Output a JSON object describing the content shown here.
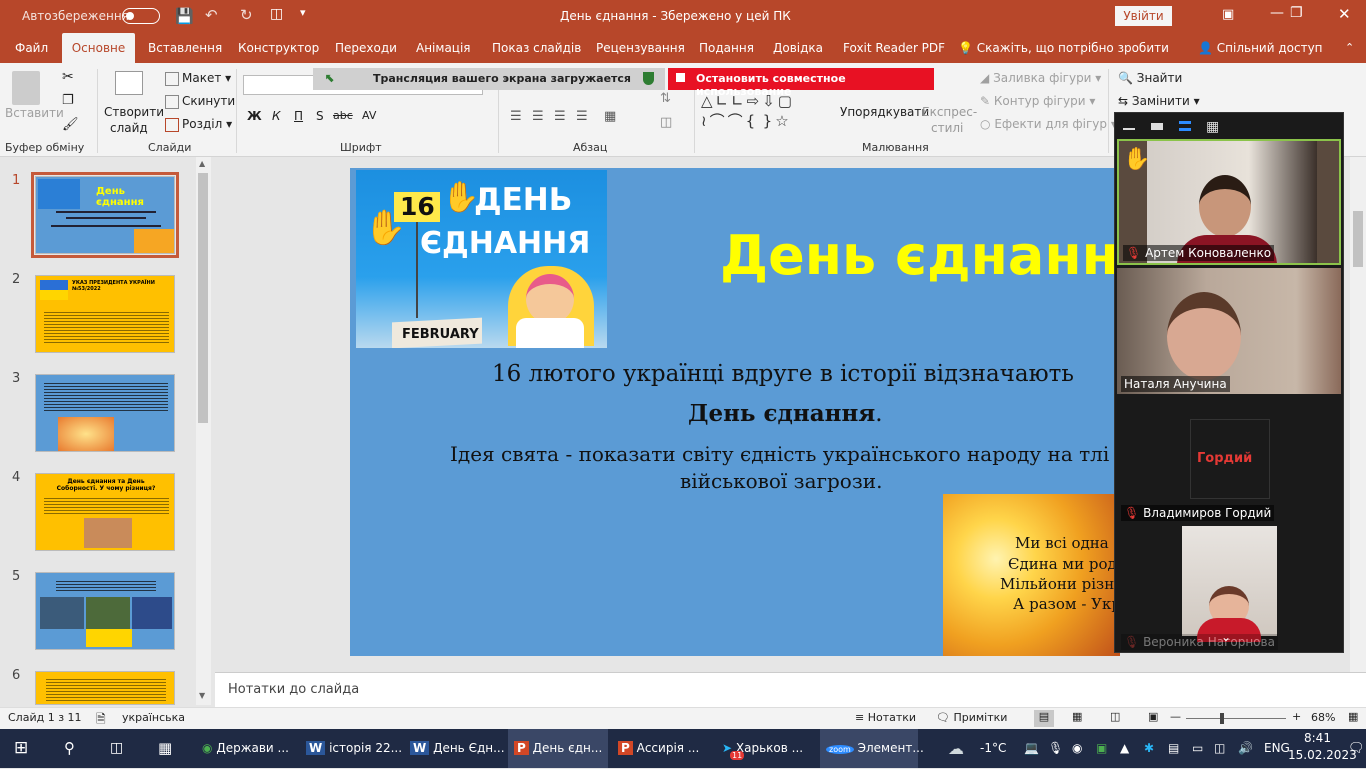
{
  "titlebar": {
    "autosave": "Автозбереження",
    "title": "День єднання  -  Збережено у цей ПК",
    "signin": "Увійти"
  },
  "tabs": [
    "Файл",
    "Основне",
    "Вставлення",
    "Конструктор",
    "Переходи",
    "Анімація",
    "Показ слайдів",
    "Рецензування",
    "Подання",
    "Довідка",
    "Foxit Reader PDF"
  ],
  "tellme": "Скажіть, що потрібно зробити",
  "share": "Спільний доступ",
  "ribbon": {
    "paste": "Вставити",
    "new_slide_1": "Створити",
    "new_slide_2": "слайд",
    "layout": "Макет",
    "reset": "Скинути",
    "section": "Розділ",
    "bold": "Ж",
    "italic": "К",
    "underline": "П",
    "strike": "S",
    "abc": "abc",
    "spacing": "AV",
    "arrange": "Упорядкувати",
    "quick_1": "Експрес-",
    "quick_2": "стилі",
    "fill": "Заливка фігури",
    "outline": "Контур фігури",
    "effects": "Ефекти для фігур",
    "find": "Знайти",
    "replace": "Замінити",
    "groups": {
      "clipboard": "Буфер обміну",
      "slides": "Слайди",
      "font": "Шрифт",
      "paragraph": "Абзац",
      "drawing": "Малювання"
    }
  },
  "screenshare": {
    "loading": "Трансляция вашего экрана загружается",
    "stop": "Остановить совместное использование"
  },
  "thumbnails": [
    {
      "num": "1",
      "title": "День єднання"
    },
    {
      "num": "2",
      "title": "УКАЗ ПРЕЗИДЕНТА УКРАЇНИ №53/2022"
    },
    {
      "num": "3",
      "title": ""
    },
    {
      "num": "4",
      "title": "День єднання та День Соборності. У чому різниця?"
    },
    {
      "num": "5",
      "title": ""
    },
    {
      "num": "6",
      "title": ""
    }
  ],
  "slide": {
    "badge_num": "16",
    "badge_1": "ДЕНЬ",
    "badge_2": "ЄДНАННЯ",
    "month": "FEBRUARY",
    "title": "День єднання",
    "line1": "16 лютого українці вдруге в історії відзначають",
    "line2": "День єднання",
    "line2_end": ".",
    "line3": "Ідея свята -  показати світу єдність українського народу на тлі",
    "line4": "військової загрози.",
    "poem": [
      "Ми всі одна сі",
      "Єдина ми роди",
      "Мільйони  різн",
      "А разом - Укра"
    ]
  },
  "notes": "Нотатки до слайда",
  "status": {
    "slide": "Слайд 1 з 11",
    "lang": "українська",
    "notes": "Нотатки",
    "comments": "Примітки",
    "zoom": "68%"
  },
  "zoom": {
    "participants": [
      {
        "name": "Артем Коноваленко"
      },
      {
        "name": "Наталя Анучина"
      },
      {
        "name": "Владимиров Гордий",
        "avatar": "Гордий"
      },
      {
        "name": "Вероника Нагорнова"
      }
    ]
  },
  "taskbar": {
    "apps": [
      "Держави ...",
      "історія 22...",
      "День Єдн...",
      "День єдн...",
      "Ассирія ...",
      "Харьков ...",
      "Элемент..."
    ],
    "telegram_badge": "11",
    "temp": "-1°C",
    "lang": "ENG",
    "time": "8:41",
    "date": "15.02.2023"
  }
}
